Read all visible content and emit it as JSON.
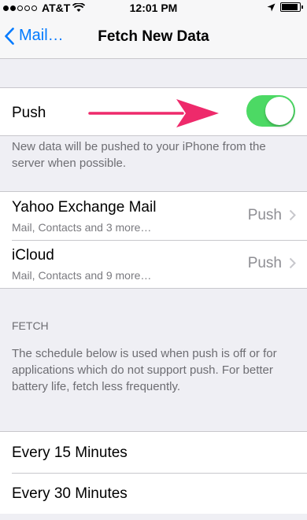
{
  "status_bar": {
    "carrier": "AT&T",
    "time": "12:01 PM"
  },
  "nav": {
    "back_label": "Mail…",
    "title": "Fetch New Data"
  },
  "push": {
    "label": "Push",
    "enabled": true,
    "description": "New data will be pushed to your iPhone from the server when possible."
  },
  "accounts": [
    {
      "name": "Yahoo Exchange Mail",
      "detail": "Mail, Contacts and 3 more…",
      "value": "Push"
    },
    {
      "name": "iCloud",
      "detail": "Mail, Contacts and 9 more…",
      "value": "Push"
    }
  ],
  "fetch": {
    "header": "FETCH",
    "description": "The schedule below is used when push is off or for applications which do not support push. For better battery life, fetch less frequently.",
    "options": [
      "Every 15 Minutes",
      "Every 30 Minutes"
    ]
  },
  "colors": {
    "accent": "#007aff",
    "toggle_on": "#4cd964",
    "annotation_arrow": "#ee2a6b"
  }
}
